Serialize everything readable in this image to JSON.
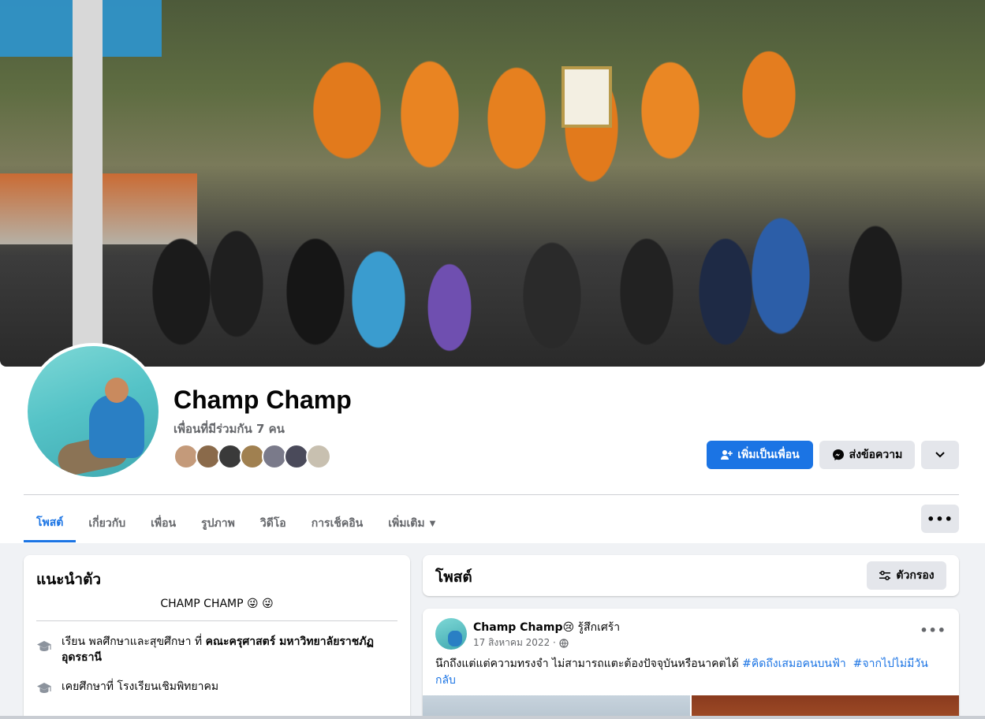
{
  "profile": {
    "name": "Champ Champ",
    "mutual_friends": "เพื่อนที่มีร่วมกัน 7 คน",
    "mutual_friend_count": 7,
    "mutual_avatar_colors": [
      "#c49a7a",
      "#8a6a4a",
      "#3a3a3a",
      "#a08050",
      "#7a7a8a",
      "#4a4a5a",
      "#c8c0b0"
    ]
  },
  "actions": {
    "add_friend": "เพิ่มเป็นเพื่อน",
    "message": "ส่งข้อความ"
  },
  "tabs": [
    {
      "label": "โพสต์",
      "active": true
    },
    {
      "label": "เกี่ยวกับ"
    },
    {
      "label": "เพื่อน"
    },
    {
      "label": "รูปภาพ"
    },
    {
      "label": "วิดีโอ"
    },
    {
      "label": "การเช็คอิน"
    },
    {
      "label": "เพิ่มเติม"
    }
  ],
  "intro": {
    "title": "แนะนำตัว",
    "bio": "CHAMP CHAMP 😜 😜",
    "education_1_prefix": "เรียน พลศึกษาและสุขศึกษา ที่ ",
    "education_1_school": "คณะครุศาสตร์ มหาวิทยาลัยราชภัฏอุดรธานี",
    "education_2": "เคยศึกษาที่ โรงเรียนเชิมพิทยาคม"
  },
  "posts_section": {
    "title": "โพสต์",
    "filter_label": "ตัวกรอง"
  },
  "post": {
    "author": "Champ Champ",
    "feeling": "😢 รู้สึกเศร้า",
    "date": "17 สิงหาคม 2022 ·",
    "text": "นึกถึงแต่แต่ความทรงจำ ไม่สามารถแตะต้องปัจจุบันหรือนาคตได้ ",
    "hashtag_1": "#คิดถึงเสมอคนบนฟ้า",
    "hashtag_2": "#จากไปไม่มีวันกลับ"
  },
  "colors": {
    "accent": "#1b74e4",
    "page_bg": "#f0f2f5",
    "button_grey": "#e4e6eb",
    "secondary_text": "#65676b"
  }
}
